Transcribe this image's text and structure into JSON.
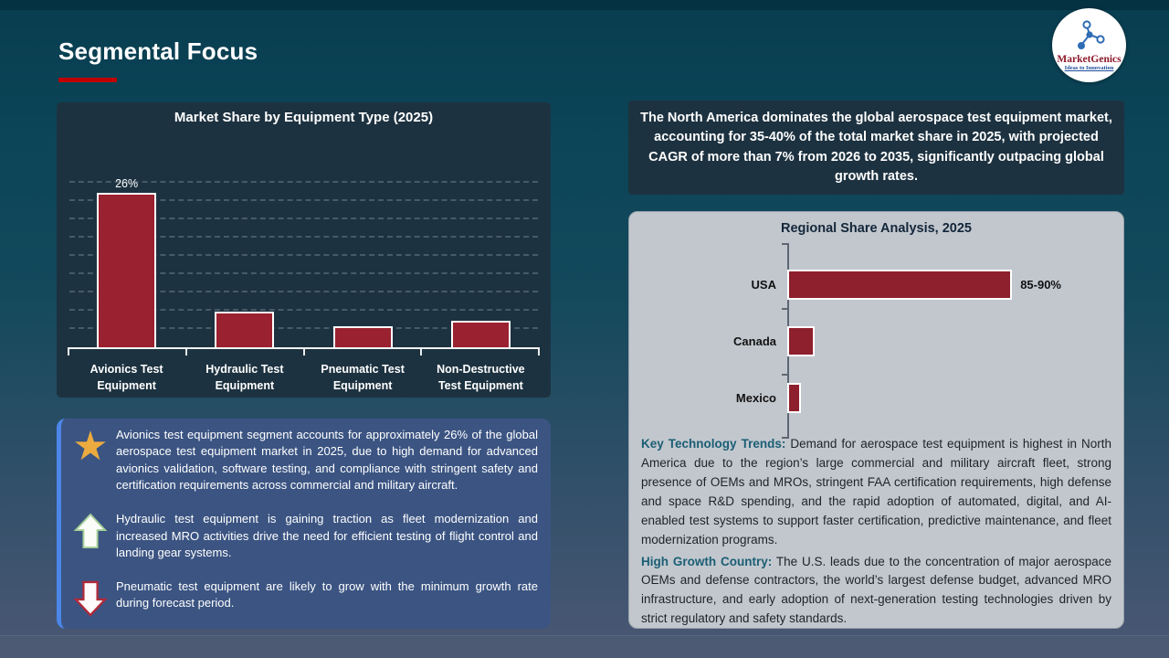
{
  "slide": {
    "title": "Segmental Focus"
  },
  "logo": {
    "brand": "MarketGenics",
    "tagline": "Ideas to Innovation"
  },
  "colors": {
    "accent_rule": "#c00000",
    "bar_red": "#9a2130",
    "hbar_red": "#8e1f2c",
    "teal_label": "#1b5e74",
    "gold_star": "#ecab3f",
    "panel_dark": "#1d3240",
    "panel_gray": "#c2c7ce",
    "insight_blue": "#3b5482"
  },
  "chart_data": [
    {
      "type": "bar",
      "orientation": "vertical",
      "title": "Market Share by Equipment Type (2025)",
      "categories": [
        "Avionics Test Equipment",
        "Hydraulic Test Equipment",
        "Pneumatic Test Equipment",
        "Non-Destructive Test Equipment"
      ],
      "values": [
        26,
        6,
        3.5,
        4.5
      ],
      "data_labels": [
        "26%",
        "",
        "",
        ""
      ],
      "ylim": [
        0,
        30
      ],
      "grid": "dashed horizontal",
      "legend": "none",
      "bar_color": "#9a2130"
    },
    {
      "type": "bar",
      "orientation": "horizontal",
      "title": "Regional Share Analysis, 2025",
      "categories": [
        "USA",
        "Canada",
        "Mexico"
      ],
      "values": [
        87.5,
        10,
        5
      ],
      "data_labels": [
        "85-90%",
        "",
        ""
      ],
      "xlim": [
        0,
        100
      ],
      "grid": "off",
      "legend": "none",
      "bar_color": "#8e1f2c"
    }
  ],
  "insights": [
    {
      "icon": "star-icon",
      "text": "Avionics test equipment segment accounts for approximately 26% of the global aerospace test equipment market in 2025, due to high demand for advanced avionics validation, software testing, and compliance with stringent safety and certification requirements across commercial and military aircraft."
    },
    {
      "icon": "arrow-up-icon",
      "text": "Hydraulic test equipment is gaining traction as fleet modernization and increased MRO activities drive the need for efficient testing of flight control and landing gear systems."
    },
    {
      "icon": "arrow-down-icon",
      "text": "Pneumatic test equipment are likely to grow with the minimum growth rate during forecast period."
    }
  ],
  "right": {
    "headline": "The North America dominates the global aerospace test equipment market, accounting for 35-40% of the total market share in 2025, with projected CAGR of more than 7% from 2026 to 2035, significantly outpacing global growth rates.",
    "panel_title": "Regional Share Analysis, 2025",
    "notes": [
      {
        "label": "Key Technology Trends:",
        "text": " Demand for aerospace test equipment is highest in North America due to the region’s large commercial and military aircraft fleet, strong presence of OEMs and MROs, stringent FAA certification requirements, high defense and space R&D spending, and the rapid adoption of automated, digital, and AI-enabled test systems to support faster certification, predictive maintenance, and fleet modernization programs."
      },
      {
        "label": "High Growth Country:",
        "text": " The U.S. leads due to the concentration of major aerospace OEMs and defense contractors, the world’s largest defense budget, advanced MRO infrastructure, and early adoption of next-generation testing technologies driven by strict regulatory and safety standards."
      }
    ]
  }
}
